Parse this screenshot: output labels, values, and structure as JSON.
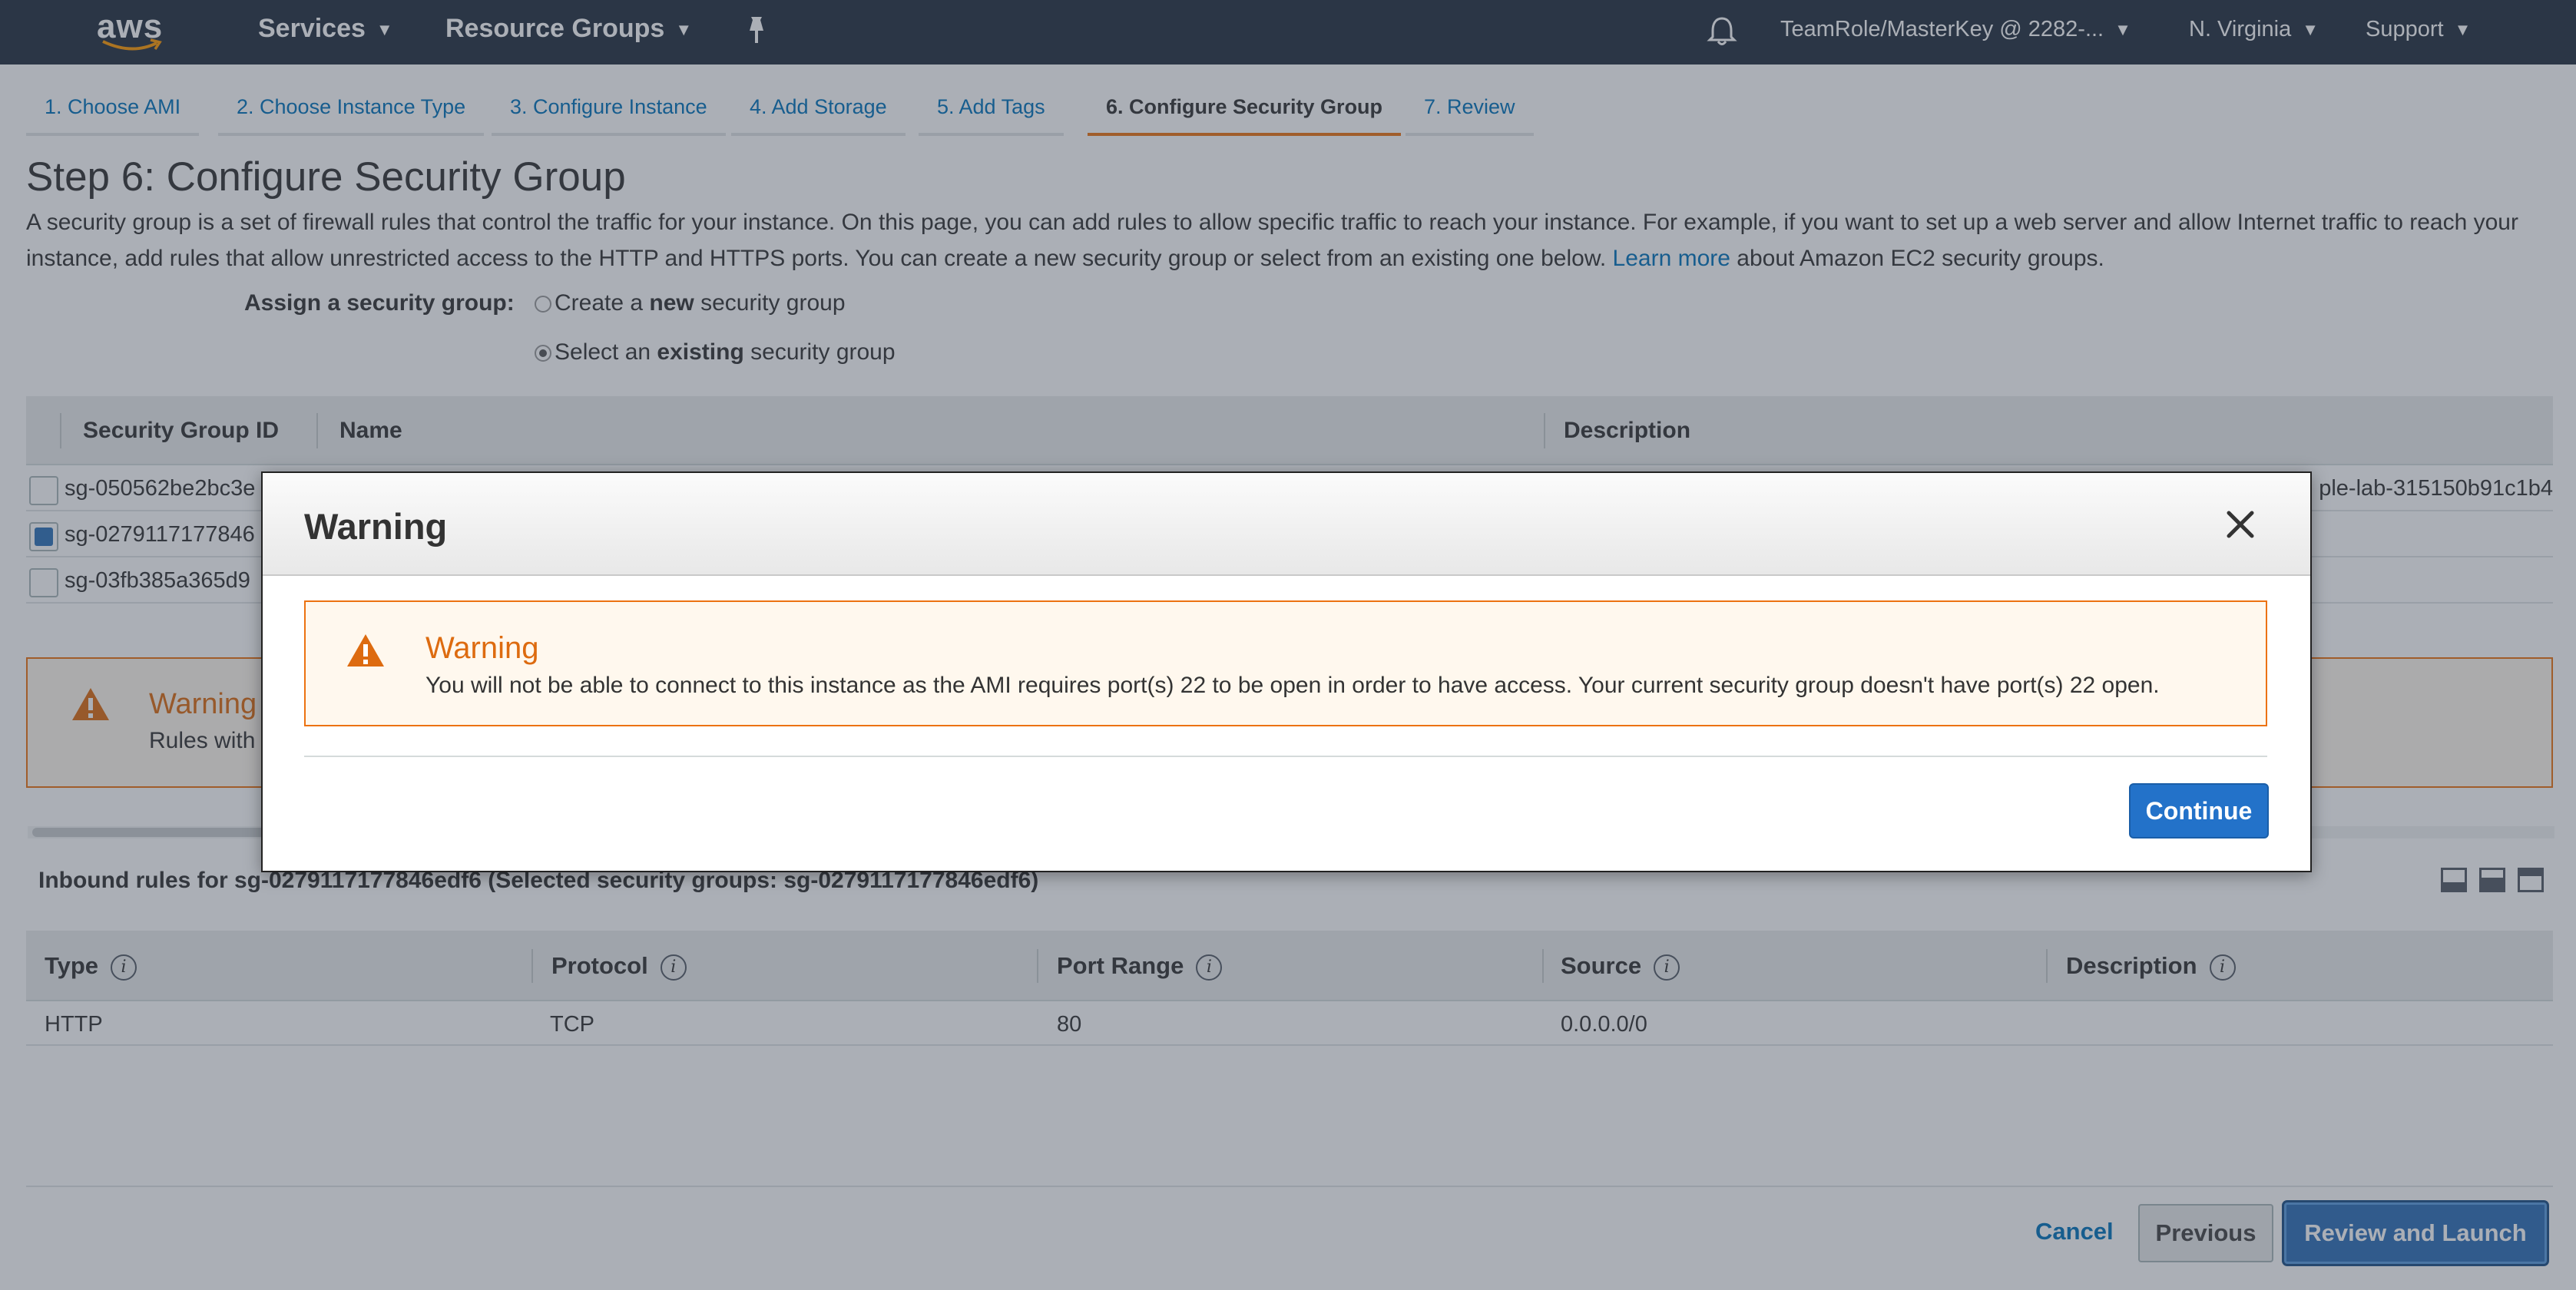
{
  "topnav": {
    "logo": "aws",
    "services": "Services",
    "resource_groups": "Resource Groups",
    "account": "TeamRole/MasterKey @ 2282-...",
    "region": "N. Virginia",
    "support": "Support"
  },
  "steps": [
    "1. Choose AMI",
    "2. Choose Instance Type",
    "3. Configure Instance",
    "4. Add Storage",
    "5. Add Tags",
    "6. Configure Security Group",
    "7. Review"
  ],
  "page": {
    "title": "Step 6: Configure Security Group",
    "description": "A security group is a set of firewall rules that control the traffic for your instance. On this page, you can add rules to allow specific traffic to reach your instance. For example, if you want to set up a web server and allow Internet traffic to reach your instance, add rules that allow unrestricted access to the HTTP and HTTPS ports. You can create a new security group or select from an existing one below.",
    "learn_more": "Learn more",
    "description_tail": "about Amazon EC2 security groups."
  },
  "assign": {
    "label": "Assign a security group:",
    "opt_new_pre": "Create a ",
    "opt_new_bold": "new",
    "opt_new_post": " security group",
    "opt_existing_pre": "Select an ",
    "opt_existing_bold": "existing",
    "opt_existing_post": " security group"
  },
  "sg_table": {
    "headers": [
      "Security Group ID",
      "Name",
      "Description"
    ],
    "rows": [
      {
        "id": "sg-050562be2bc3e",
        "extra": "ple-lab-315150b91c1b4",
        "checked": false
      },
      {
        "id": "sg-0279117177846",
        "extra": "",
        "checked": true
      },
      {
        "id": "sg-03fb385a365d9",
        "extra": "",
        "checked": false
      }
    ]
  },
  "bg_warning": {
    "title": "Warning",
    "text": "Rules with"
  },
  "inbound": {
    "title": "Inbound rules for sg-0279117177846edf6 (Selected security groups: sg-0279117177846edf6)",
    "headers": [
      "Type",
      "Protocol",
      "Port Range",
      "Source",
      "Description"
    ],
    "rows": [
      {
        "type": "HTTP",
        "protocol": "TCP",
        "port": "80",
        "source": "0.0.0.0/0",
        "description": ""
      }
    ]
  },
  "footer": {
    "cancel": "Cancel",
    "previous": "Previous",
    "review": "Review and Launch"
  },
  "modal": {
    "title": "Warning",
    "alert_title": "Warning",
    "alert_message": "You will not be able to connect to this instance as the AMI requires port(s) 22 to be open in order to have access. Your current security group doesn't have port(s) 22 open.",
    "continue": "Continue"
  },
  "colors": {
    "nav_bg": "#232f3e",
    "link": "#0073bb",
    "warning": "#ec7211",
    "primary": "#2372c9"
  }
}
